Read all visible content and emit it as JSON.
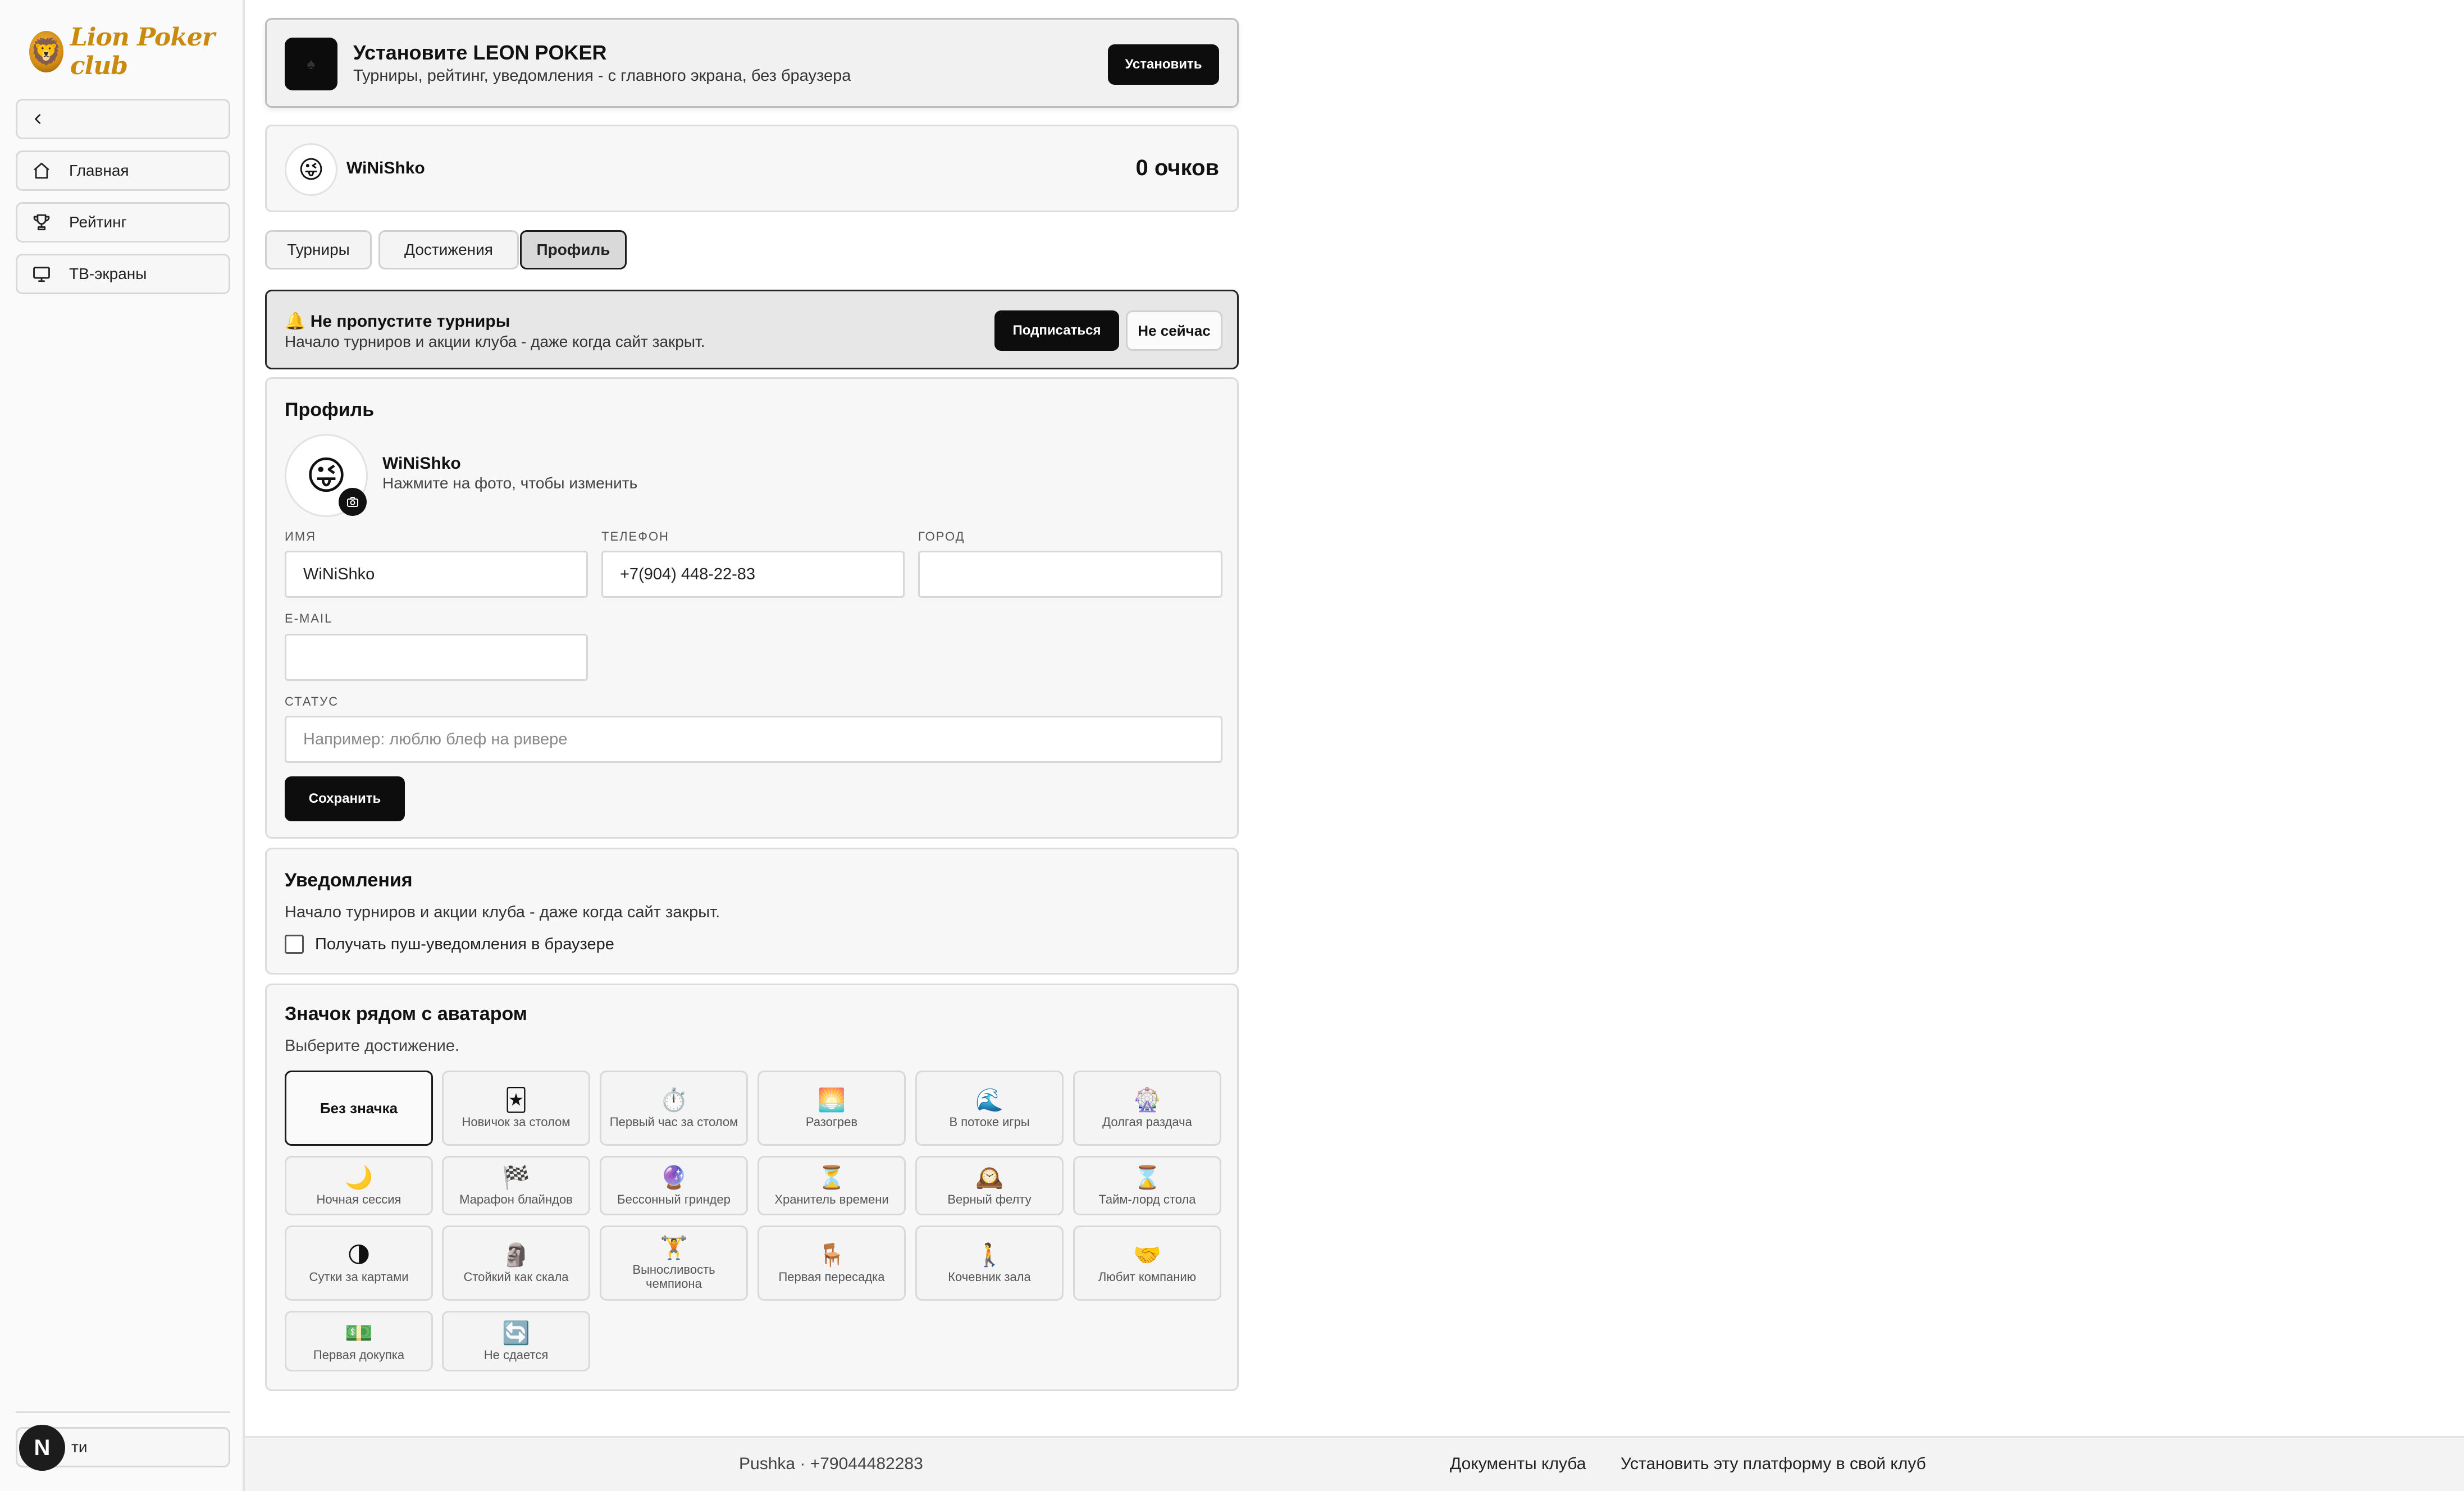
{
  "brand": {
    "logo_text": "Lion Poker club"
  },
  "sidebar": {
    "items": [
      {
        "label": "Главная"
      },
      {
        "label": "Рейтинг"
      },
      {
        "label": "ТВ-экраны"
      }
    ],
    "bottom_label": "ти",
    "n_badge": "N"
  },
  "install_banner": {
    "title": "Установите LEON POKER",
    "subtitle": "Турниры, рейтинг, уведомления - с главного экрана, без браузера",
    "button": "Установить"
  },
  "user": {
    "name": "WiNiShko",
    "points": "0 очков",
    "avatar_emoji": "😜"
  },
  "tabs": [
    {
      "label": "Турниры"
    },
    {
      "label": "Достижения"
    },
    {
      "label": "Профиль"
    }
  ],
  "notify_banner": {
    "title": "Не пропустите турниры",
    "icon": "🔔",
    "subtitle": "Начало турниров и акции клуба - даже когда сайт закрыт.",
    "subscribe": "Подписаться",
    "later": "Не сейчас"
  },
  "profile": {
    "title": "Профиль",
    "name": "WiNiShko",
    "hint": "Нажмите на фото, чтобы изменить",
    "fields": {
      "name_label": "Имя",
      "name_value": "WiNiShko",
      "phone_label": "Телефон",
      "phone_value": "+7(904) 448-22-83",
      "city_label": "Город",
      "city_value": "",
      "email_label": "E-mail",
      "email_value": "",
      "status_label": "Статус",
      "status_placeholder": "Например: люблю блеф на ривере"
    },
    "save": "Сохранить"
  },
  "notifications": {
    "title": "Уведомления",
    "text": "Начало турниров и акции клуба - даже когда сайт закрыт.",
    "checkbox_label": "Получать пуш-уведомления в браузере",
    "checked": false
  },
  "badges": {
    "title": "Значок рядом с аватаром",
    "subtitle": "Выберите достижение.",
    "items": [
      {
        "emoji": "",
        "label": "Без значка"
      },
      {
        "emoji": "🃏",
        "label": "Новичок за столом"
      },
      {
        "emoji": "⏱️",
        "label": "Первый час за столом"
      },
      {
        "emoji": "🌅",
        "label": "Разогрев"
      },
      {
        "emoji": "🌊",
        "label": "В потоке игры"
      },
      {
        "emoji": "🎡",
        "label": "Долгая раздача"
      },
      {
        "emoji": "🌙",
        "label": "Ночная сессия"
      },
      {
        "emoji": "🏁",
        "label": "Марафон блайндов"
      },
      {
        "emoji": "🔮",
        "label": "Бессонный гриндер"
      },
      {
        "emoji": "⏳",
        "label": "Хранитель времени"
      },
      {
        "emoji": "🕰️",
        "label": "Верный фелту"
      },
      {
        "emoji": "⌛",
        "label": "Тайм-лорд стола"
      },
      {
        "emoji": "🌗",
        "label": "Сутки за картами"
      },
      {
        "emoji": "🗿",
        "label": "Стойкий как скала"
      },
      {
        "emoji": "🏋️",
        "label": "Выносливость чемпиона"
      },
      {
        "emoji": "🪑",
        "label": "Первая пересадка"
      },
      {
        "emoji": "🚶",
        "label": "Кочевник зала"
      },
      {
        "emoji": "🤝",
        "label": "Любит компанию"
      },
      {
        "emoji": "💵",
        "label": "Первая докупка"
      },
      {
        "emoji": "🔄",
        "label": "Не сдается"
      }
    ]
  },
  "footer": {
    "contact": "Pushka · +79044482283",
    "docs": "Документы клуба",
    "install_platform": "Установить эту платформу в свой клуб"
  }
}
